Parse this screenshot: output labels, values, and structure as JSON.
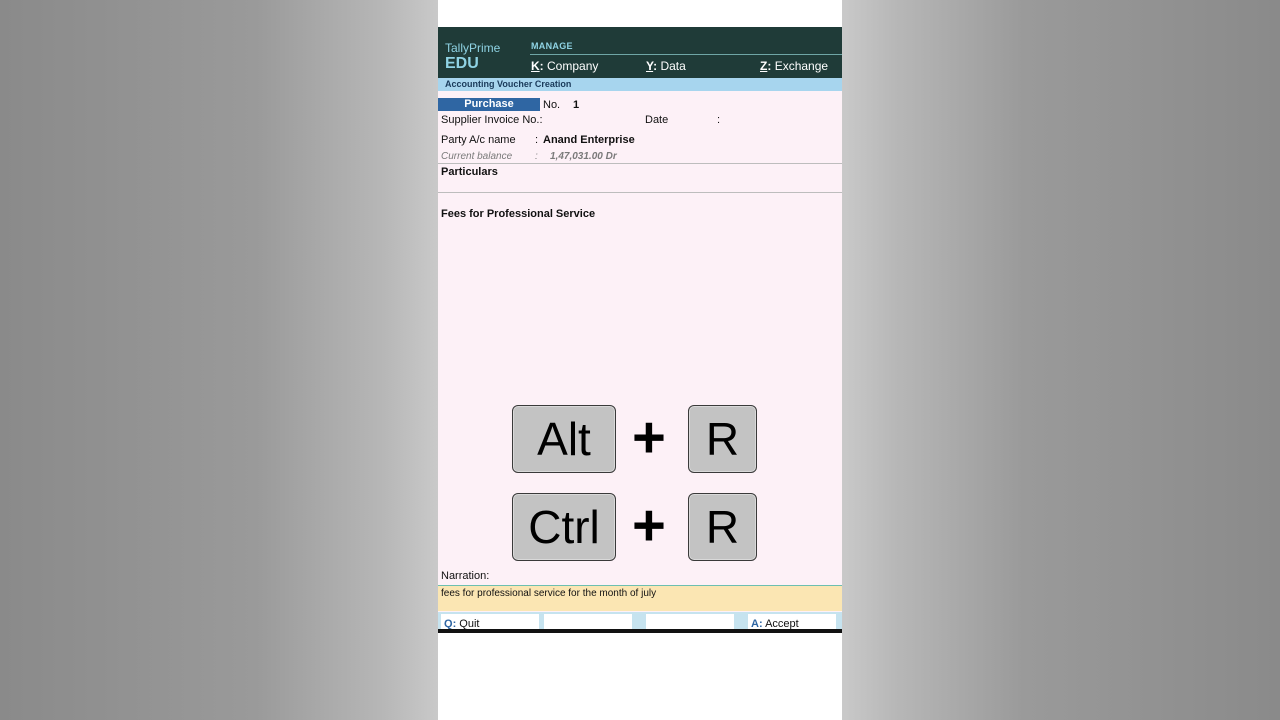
{
  "app": {
    "brand_line1": "TallyPrime",
    "brand_line2": "EDU",
    "manage_label": "MANAGE",
    "menu": [
      {
        "key": "K",
        "label": "Company"
      },
      {
        "key": "Y",
        "label": "Data"
      },
      {
        "key": "Z",
        "label": "Exchange"
      }
    ],
    "screen_title": "Accounting Voucher Creation"
  },
  "voucher": {
    "type": "Purchase",
    "no_label": "No.",
    "no_value": "1",
    "supplier_invoice_label": "Supplier Invoice No.:",
    "date_label": "Date",
    "date_sep": ":",
    "party_label": "Party A/c name",
    "party_sep": ":",
    "party_value": "Anand Enterprise",
    "balance_label": "Current balance",
    "balance_sep": ":",
    "balance_value": "1,47,031.00 Dr",
    "particulars_header": "Particulars",
    "particular_item": "Fees for Professional Service",
    "narration_label": "Narration:",
    "narration_value": "fees for professional service for the month of july"
  },
  "shortcuts": [
    {
      "modifier": "Alt",
      "plus": "+",
      "key": "R"
    },
    {
      "modifier": "Ctrl",
      "plus": "+",
      "key": "R"
    }
  ],
  "footer": {
    "quit_key": "Q",
    "quit_label": "Quit",
    "accept_key": "A",
    "accept_label": "Accept"
  },
  "colors": {
    "header_bg": "#1f3b38",
    "accent": "#2f66a3",
    "body_bg": "#fdf1f7",
    "narration_bg": "#fbe6b3"
  }
}
